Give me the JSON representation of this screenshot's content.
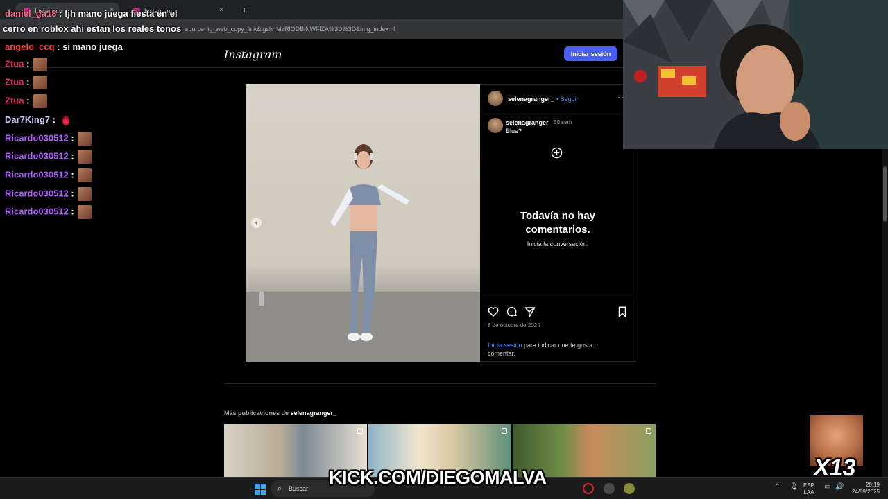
{
  "browser": {
    "tabs": [
      {
        "label": "Instagram",
        "active": true
      },
      {
        "label": "Instagram",
        "active": false
      }
    ],
    "new_tab_symbol": "+",
    "close_symbol": "×",
    "url_visible": "source=ig_web_copy_link&igsh=MzRlODBiNWFlZA%3D%3D&img_index=4"
  },
  "instagram": {
    "logo": "Instagram",
    "login_button": "Iniciar sesión",
    "post": {
      "username": "selenagranger_",
      "follow_label": "• Seguir",
      "more_symbol": "···",
      "caption_username": "selenagranger_",
      "time_ago": "50 sem",
      "caption": "Blue?",
      "no_comments_title": "Todavía no hay comentarios.",
      "no_comments_sub": "Inicia la conversación.",
      "date": "8 de octubre de 2024",
      "login_link": "Inicia sesión",
      "login_hint_rest": " para indicar que te gusta o comentar.",
      "prev_symbol": "‹"
    },
    "more_posts_prefix": "Más publicaciones de ",
    "more_posts_user": "selenagranger_"
  },
  "chat": [
    {
      "user": "daniel_ga18",
      "color": "#ff6b8a",
      "text": "!jh mano juega fiesta en el"
    },
    {
      "user": "",
      "color": "#ffffff",
      "text": "cerro en roblox ahi estan los reales tonos"
    },
    {
      "user": "angelo_ccq",
      "color": "#ff3b3b",
      "text": "si mano juega"
    },
    {
      "user": "Ztua",
      "color": "#e0245e",
      "text": ""
    },
    {
      "user": "Ztua",
      "color": "#e0245e",
      "text": ""
    },
    {
      "user": "Ztua",
      "color": "#e0245e",
      "text": ""
    },
    {
      "user": "Dar7King7",
      "color": "#d9c7ff",
      "text": ""
    },
    {
      "user": "Ricardo030512",
      "color": "#b05cff",
      "text": ""
    },
    {
      "user": "Ricardo030512",
      "color": "#b05cff",
      "text": ""
    },
    {
      "user": "Ricardo030512",
      "color": "#b05cff",
      "text": ""
    },
    {
      "user": "Ricardo030512",
      "color": "#b05cff",
      "text": ""
    },
    {
      "user": "Ricardo030512",
      "color": "#b05cff",
      "text": ""
    }
  ],
  "overlay": {
    "kick": "KICK.COM/DIEGOMALVA",
    "multiplier": "X13"
  },
  "taskbar": {
    "search_label": "Buscar",
    "lang_top": "ESP",
    "lang_bottom": "LAA",
    "time": "20:19",
    "date": "24/09/2025"
  },
  "colors": {
    "accent": "#4a5df9",
    "link": "#4a90f0"
  }
}
